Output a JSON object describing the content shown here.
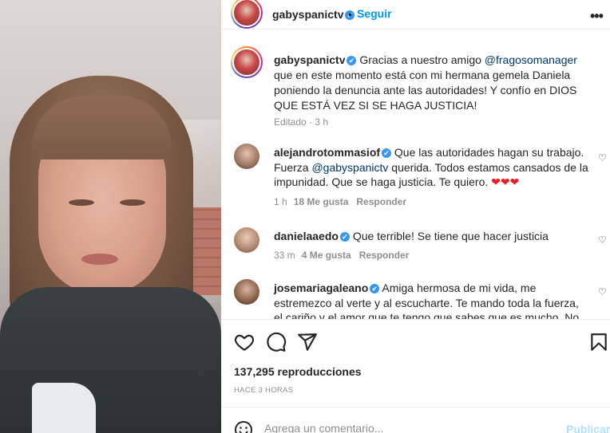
{
  "post": {
    "username": "gabyspanictv",
    "follow_label": "Seguir",
    "dot": "•",
    "more_label": "•••",
    "caption": {
      "username": "gabyspanictv",
      "text_before": "Gracias a nuestro amigo ",
      "mention": "@fragosomanager",
      "text_after": " que en este momento está con mi hermana gemela Daniela poniendo la denuncia ante las autoridades! Y confío en DIOS QUE ESTÁ VEZ SI SE HAGA JUSTICIA!",
      "edited": "Editado · 3 h"
    }
  },
  "comments": [
    {
      "username": "alejandrotommasiof",
      "text_before": "Que las autoridades hagan su trabajo. Fuerza ",
      "mention": "@gabyspanictv",
      "text_after": " querida. Todos estamos cansados de la impunidad. Que se haga justicia. Te quiero. ",
      "emoji": "❤❤❤",
      "time": "1 h",
      "likes": "18 Me gusta",
      "reply": "Responder"
    },
    {
      "username": "danielaaedo",
      "text": "Que terrible! Se tiene que hacer justicia",
      "time": "33 m",
      "likes": "4 Me gusta",
      "reply": "Responder"
    },
    {
      "username": "josemariagaleano",
      "text": "Amiga hermosa de mi vida, me estremezco al verte y al escucharte. Te mando toda la fuerza, el cariño y el amor que te tengo que sabes que es mucho. No te"
    }
  ],
  "footer": {
    "views": "137,295 reproducciones",
    "time_ago": "HACE 3 HORAS",
    "comment_placeholder": "Agrega un comentario...",
    "publish_label": "Publicar"
  },
  "icons": {
    "verified": "✔",
    "heart_small": "♡"
  },
  "colors": {
    "accent": "#0095f6",
    "verified": "#3897f0",
    "mention": "#00376b",
    "muted": "#8e8e8e",
    "publish_disabled": "#b2dffc"
  }
}
